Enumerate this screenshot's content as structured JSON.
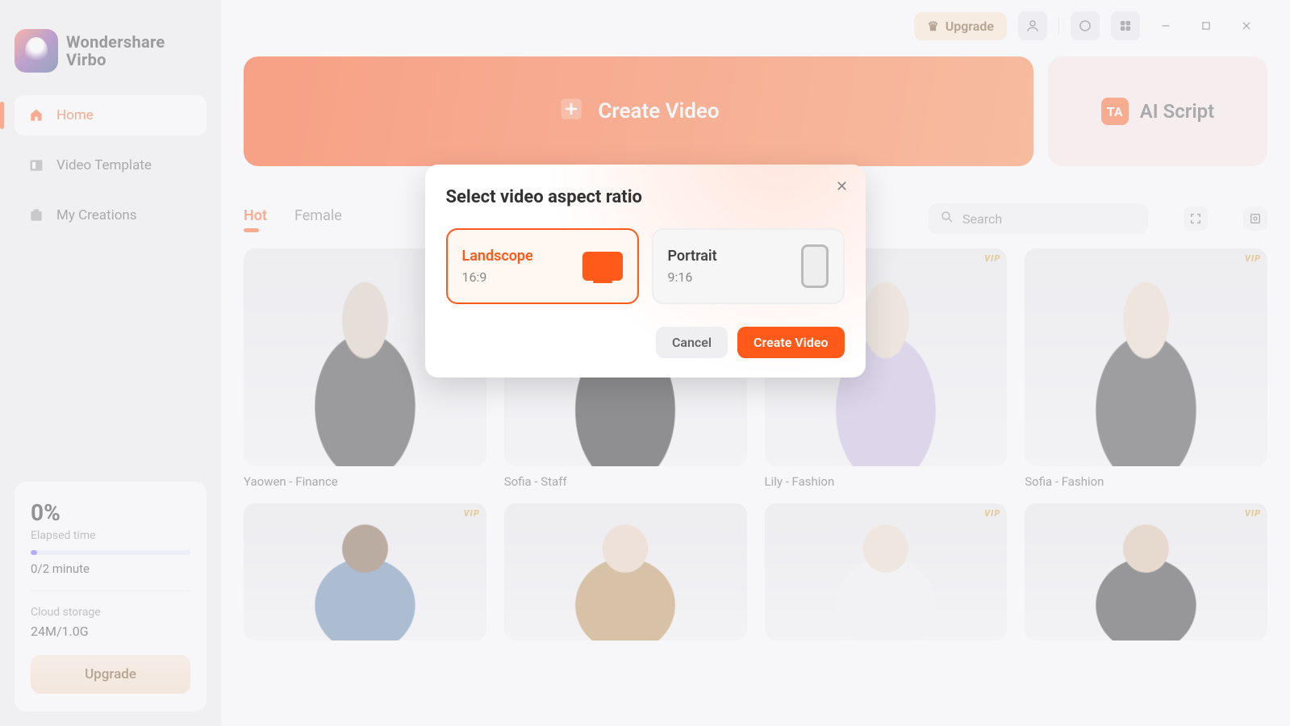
{
  "brand": {
    "line1": "Wondershare",
    "line2": "Virbo"
  },
  "sidebar": {
    "items": [
      {
        "label": "Home"
      },
      {
        "label": "Video Template"
      },
      {
        "label": "My Creations"
      }
    ]
  },
  "stats": {
    "percent": "0%",
    "elapsed_label": "Elapsed time",
    "minute": "0/2 minute",
    "storage_label": "Cloud storage",
    "storage_value": "24M/1.0G",
    "upgrade": "Upgrade"
  },
  "titlebar": {
    "upgrade": "Upgrade"
  },
  "hero": {
    "create": "Create Video",
    "ai_script": "AI Script",
    "ai_icon": "TA"
  },
  "tabs": [
    "Hot",
    "Female"
  ],
  "search": {
    "placeholder": "Search"
  },
  "avatars": [
    {
      "name": "Yaowen - Finance",
      "vip": false
    },
    {
      "name": "Sofia - Staff",
      "vip": false
    },
    {
      "name": "Lily - Fashion",
      "vip": true
    },
    {
      "name": "Sofia - Fashion",
      "vip": true
    },
    {
      "name": "",
      "vip": true
    },
    {
      "name": "",
      "vip": false
    },
    {
      "name": "",
      "vip": true
    },
    {
      "name": "",
      "vip": true
    }
  ],
  "modal": {
    "title": "Select video aspect ratio",
    "landscape": {
      "title": "Landscope",
      "ratio": "16:9"
    },
    "portrait": {
      "title": "Portrait",
      "ratio": "9:16"
    },
    "cancel": "Cancel",
    "confirm": "Create Video"
  }
}
